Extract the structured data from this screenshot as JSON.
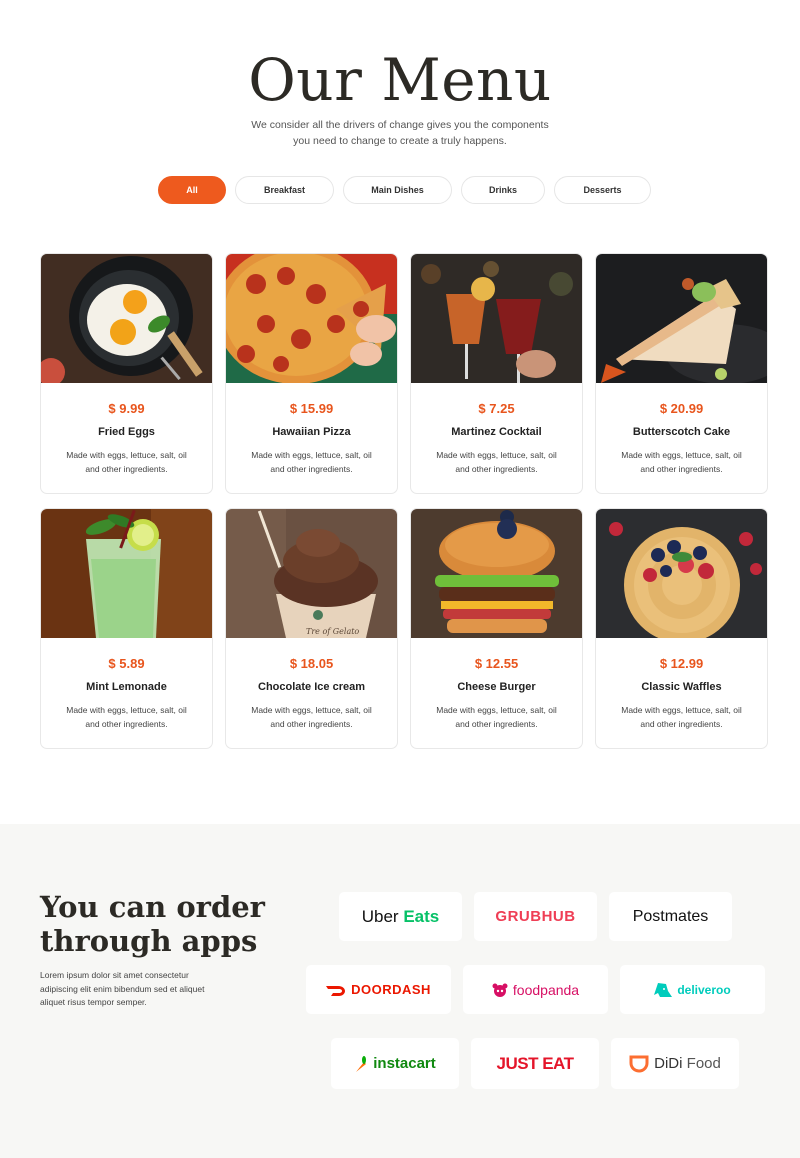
{
  "menu": {
    "title": "Our Menu",
    "subtitle_line1": "We consider all the drivers of change gives you the components",
    "subtitle_line2": "you need to change to create a truly happens.",
    "filters": [
      {
        "label": "All",
        "active": true
      },
      {
        "label": "Breakfast",
        "active": false
      },
      {
        "label": "Main Dishes",
        "active": false
      },
      {
        "label": "Drinks",
        "active": false
      },
      {
        "label": "Desserts",
        "active": false
      }
    ],
    "items": [
      {
        "price": "$ 9.99",
        "name": "Fried Eggs",
        "desc_line1": "Made with eggs, lettuce, salt, oil",
        "desc_line2": "and other ingredients.",
        "image": "fried-eggs-photo"
      },
      {
        "price": "$ 15.99",
        "name": "Hawaiian Pizza",
        "desc_line1": "Made with eggs, lettuce, salt, oil",
        "desc_line2": "and other ingredients.",
        "image": "pizza-photo"
      },
      {
        "price": "$ 7.25",
        "name": "Martinez Cocktail",
        "desc_line1": "Made with eggs, lettuce, salt, oil",
        "desc_line2": "and other ingredients.",
        "image": "cocktail-photo"
      },
      {
        "price": "$ 20.99",
        "name": "Butterscotch Cake",
        "desc_line1": "Made with eggs, lettuce, salt, oil",
        "desc_line2": "and other ingredients.",
        "image": "cake-photo"
      },
      {
        "price": "$ 5.89",
        "name": "Mint Lemonade",
        "desc_line1": "Made with eggs, lettuce, salt, oil",
        "desc_line2": "and other ingredients.",
        "image": "lemonade-photo"
      },
      {
        "price": "$ 18.05",
        "name": "Chocolate Ice cream",
        "desc_line1": "Made with eggs, lettuce, salt, oil",
        "desc_line2": "and other ingredients.",
        "image": "ice-cream-photo",
        "cup_text": "Tre of Gelato"
      },
      {
        "price": "$ 12.55",
        "name": "Cheese Burger",
        "desc_line1": "Made with eggs, lettuce, salt, oil",
        "desc_line2": "and other ingredients.",
        "image": "burger-photo"
      },
      {
        "price": "$ 12.99",
        "name": "Classic Waffles",
        "desc_line1": "Made with eggs, lettuce, salt, oil",
        "desc_line2": "and other ingredients.",
        "image": "waffles-photo"
      }
    ]
  },
  "apps": {
    "title_line1": "You can order",
    "title_line2": "through apps",
    "text_line1": "Lorem ipsum dolor sit amet consectetur",
    "text_line2": "adipiscing elit enim bibendum sed et aliquet",
    "text_line3": "aliquet risus tempor semper.",
    "partners": [
      {
        "name_a": "Uber",
        "name_b": "Eats",
        "color_a": "#111111",
        "color_b": "#06c167"
      },
      {
        "name_a": "GRUBHUB",
        "color_a": "#ef3e55"
      },
      {
        "name_a": "Postmates",
        "color_a": "#111111"
      },
      {
        "name_a": "DOORDASH",
        "color_a": "#eb1700",
        "icon": "doordash-icon"
      },
      {
        "name_a": "foodpanda",
        "color_a": "#d70f64",
        "icon": "panda-icon"
      },
      {
        "name_a": "deliveroo",
        "color_a": "#00ccbc",
        "icon": "kangaroo-icon"
      },
      {
        "name_a": "instacart",
        "color_a": "#108910",
        "icon": "carrot-icon",
        "icon_color": "#ff7009"
      },
      {
        "name_a": "JUST EAT",
        "color_a": "#e4152a"
      },
      {
        "name_a": "DiDi",
        "name_b": "Food",
        "color_a": "#333333",
        "color_b": "#555555",
        "icon": "didi-icon",
        "icon_color": "#fc6e31"
      }
    ]
  },
  "colors": {
    "accent": "#ee5a1e",
    "price": "#e8551d",
    "section_bg": "#f7f7f5"
  }
}
